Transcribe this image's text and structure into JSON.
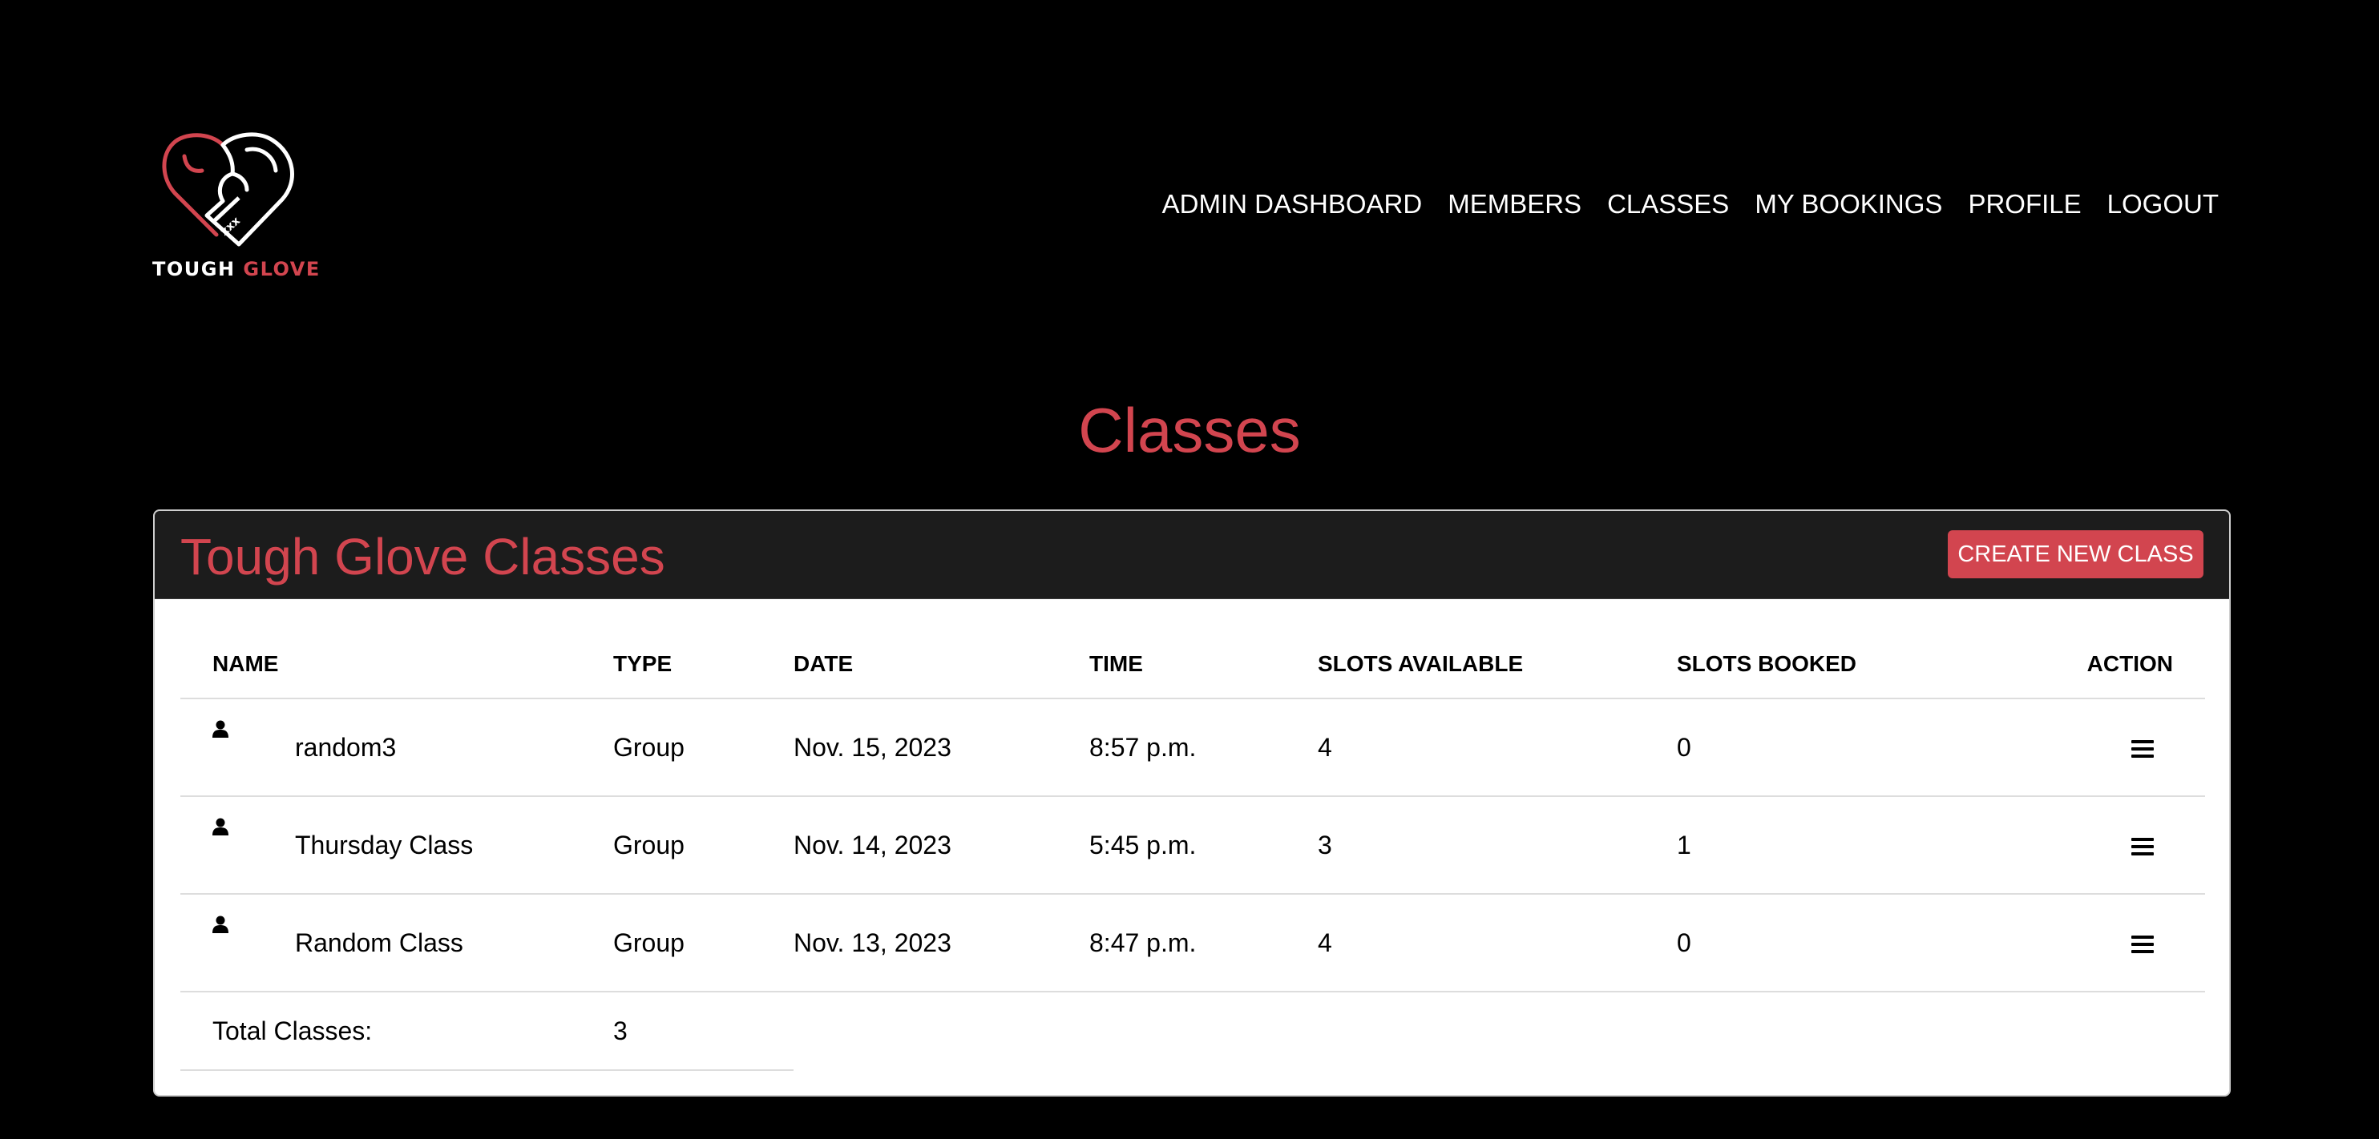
{
  "brand": {
    "logo_icon": "boxing-glove-heart-icon",
    "name_part1": "TOUGH",
    "name_part2": "GLOVE",
    "accent_color": "#d2454f"
  },
  "nav": [
    {
      "label": "ADMIN DASHBOARD"
    },
    {
      "label": "MEMBERS"
    },
    {
      "label": "CLASSES"
    },
    {
      "label": "MY BOOKINGS"
    },
    {
      "label": "PROFILE"
    },
    {
      "label": "LOGOUT"
    }
  ],
  "page_title": "Classes",
  "card": {
    "title": "Tough Glove Classes",
    "create_button": "CREATE NEW CLASS"
  },
  "table": {
    "headers": {
      "name": "NAME",
      "type": "TYPE",
      "date": "DATE",
      "time": "TIME",
      "slots_available": "SLOTS AVAILABLE",
      "slots_booked": "SLOTS BOOKED",
      "action": "ACTION"
    },
    "rows": [
      {
        "icon": "person-icon",
        "name": "random3",
        "type": "Group",
        "date": "Nov. 15, 2023",
        "time": "8:57 p.m.",
        "slots_available": "4",
        "slots_booked": "0",
        "action_icon": "menu-icon"
      },
      {
        "icon": "person-icon",
        "name": "Thursday Class",
        "type": "Group",
        "date": "Nov. 14, 2023",
        "time": "5:45 p.m.",
        "slots_available": "3",
        "slots_booked": "1",
        "action_icon": "menu-icon"
      },
      {
        "icon": "person-icon",
        "name": "Random Class",
        "type": "Group",
        "date": "Nov. 13, 2023",
        "time": "8:47 p.m.",
        "slots_available": "4",
        "slots_booked": "0",
        "action_icon": "menu-icon"
      }
    ],
    "total_label": "Total Classes:",
    "total_value": "3"
  }
}
